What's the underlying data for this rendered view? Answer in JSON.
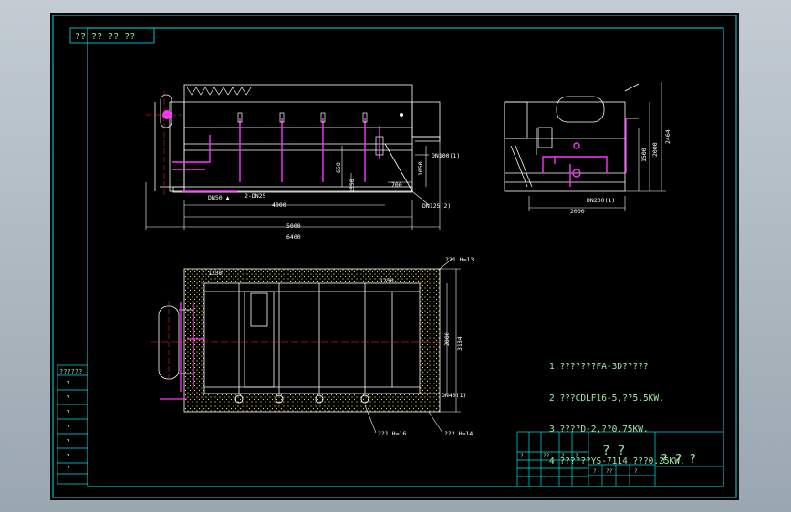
{
  "drawing": {
    "corner_marks": "?? ?? ?? ??",
    "front_view": {
      "dims": {
        "overall_length": "6400",
        "tank_length": "5000",
        "inner_length": "4000",
        "inlet_dim": "700",
        "height_1": "1050",
        "height_2": "650",
        "height_3": "1350",
        "inlet_label": "DN50 ▲",
        "pipe_label_1": "2-DN25",
        "pipe_label_2": "DN100(1)",
        "pipe_label_3": "DN125(2)"
      }
    },
    "side_view": {
      "dims": {
        "width": "2000",
        "height_total": "2464",
        "height_1": "2000",
        "height_2": "1500",
        "pipe_label": "DN200(1)"
      }
    },
    "plan_view": {
      "dims": {
        "top_1": "1250",
        "top_2": "1250",
        "width": "2000",
        "width_total": "3184",
        "bottom_pipe": "DN40(1)",
        "callout_1": "??1 H=13",
        "callout_2": "??1 H=16",
        "callout_3": "??2 H=14"
      }
    },
    "notes": [
      "1.???????FA-3D?????",
      "2.???CDLF16-5,??5.5KW.",
      "3.????D-2,??0.75KW.",
      "4.??????YS-7114,???0.25KW."
    ],
    "title_block": {
      "marks_a": "?  ?",
      "marks_b": "?  ?  ?",
      "cells": [
        "?",
        "??",
        "?",
        "?",
        "?",
        "??",
        "?"
      ]
    },
    "left_table": {
      "header": "??????",
      "rows": [
        "?",
        "?",
        "?",
        "?",
        "?",
        "?",
        "?"
      ]
    },
    "colors": {
      "background": "#000000",
      "frame": "#00e5e5",
      "geometry": "#ffffff",
      "pipes": "#ff33ff",
      "hatch": "#e6e65a",
      "red_centerline": "#ff2a2a",
      "text": "#9fe8a6"
    }
  }
}
